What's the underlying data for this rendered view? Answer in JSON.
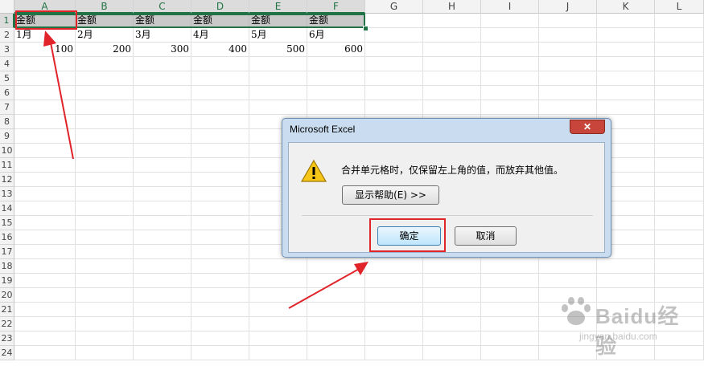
{
  "columns": [
    "A",
    "B",
    "C",
    "D",
    "E",
    "F",
    "G",
    "H",
    "I",
    "J",
    "K",
    "L"
  ],
  "rows": [
    "1",
    "2",
    "3",
    "4",
    "5",
    "6",
    "7",
    "8",
    "9",
    "10",
    "11",
    "12",
    "13",
    "14",
    "15",
    "16",
    "17",
    "18",
    "19",
    "20",
    "21",
    "22",
    "23",
    "24"
  ],
  "grid": {
    "row1": [
      "金额",
      "金额",
      "金额",
      "金额",
      "金额",
      "金额"
    ],
    "row2": [
      "1月",
      "2月",
      "3月",
      "4月",
      "5月",
      "6月"
    ],
    "row3": [
      "100",
      "200",
      "300",
      "400",
      "500",
      "600"
    ]
  },
  "dialog": {
    "title": "Microsoft Excel",
    "close_label": "✕",
    "message": "合并单元格时，仅保留左上角的值，而放弃其他值。",
    "help_button": "显示帮助(E) >>",
    "ok_button": "确定",
    "cancel_button": "取消",
    "icon": "warning-icon"
  },
  "watermark": {
    "brand": "Baidu经验",
    "url": "jingyan.baidu.com"
  },
  "colors": {
    "selection_green": "#217346",
    "annotation_red": "#e0242a"
  }
}
